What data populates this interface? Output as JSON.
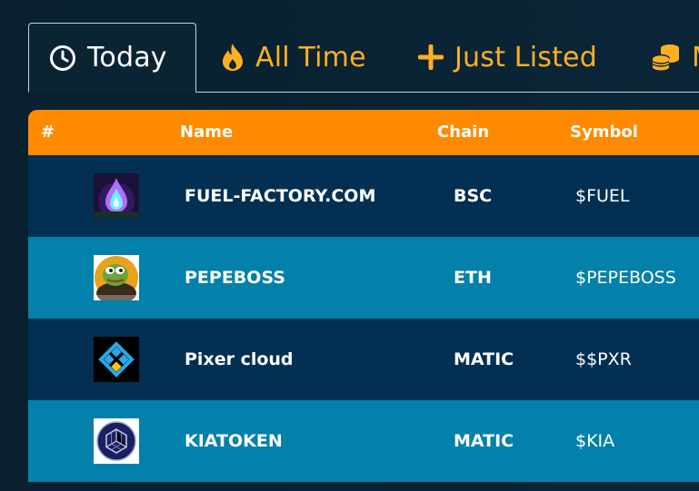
{
  "tabs": [
    {
      "label": "Today",
      "icon": "clock-icon",
      "active": true
    },
    {
      "label": "All Time",
      "icon": "flame-icon",
      "active": false
    },
    {
      "label": "Just Listed",
      "icon": "plus-icon",
      "active": false
    },
    {
      "label": "M",
      "icon": "coins-icon",
      "active": false
    }
  ],
  "table": {
    "headers": {
      "rank": "#",
      "name": "Name",
      "chain": "Chain",
      "symbol": "Symbol"
    },
    "rows": [
      {
        "name": "FUEL-FACTORY.COM",
        "chain": "BSC",
        "symbol": "$FUEL",
        "logo": "flame-drop-logo"
      },
      {
        "name": "PEPEBOSS",
        "chain": "ETH",
        "symbol": "$PEPEBOSS",
        "logo": "pepe-frog-logo"
      },
      {
        "name": "Pixer cloud",
        "chain": "MATIC",
        "symbol": "$$PXR",
        "logo": "pixer-diamond-logo"
      },
      {
        "name": "KIATOKEN",
        "chain": "MATIC",
        "symbol": "$KIA",
        "logo": "kia-cube-logo"
      }
    ]
  },
  "colors": {
    "header_orange": "#ff8a00",
    "row_dark": "#033052",
    "row_light": "#0381aa",
    "tab_accent": "#ffb020"
  }
}
